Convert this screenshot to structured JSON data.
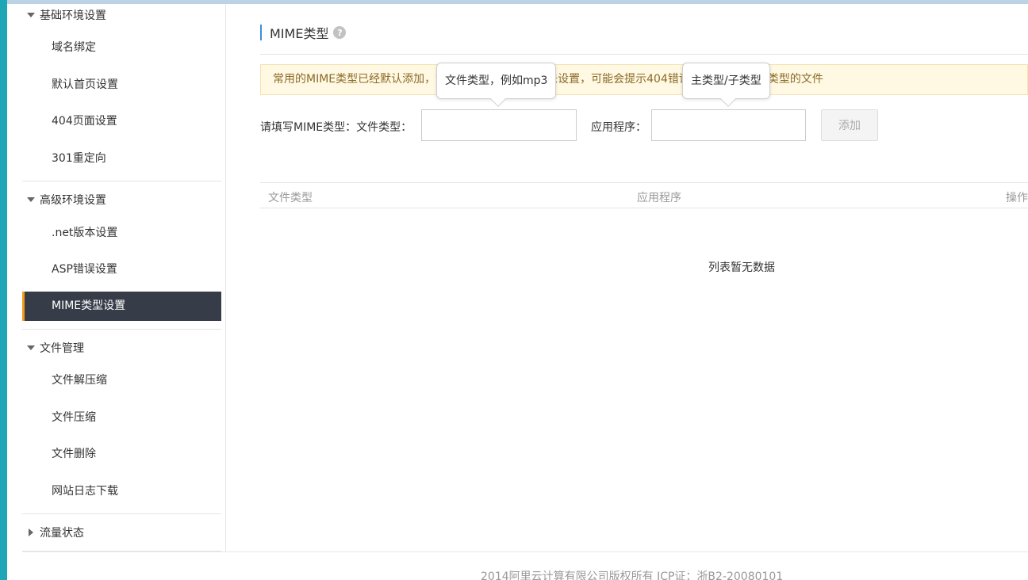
{
  "sidebar": {
    "groups": [
      {
        "label": "基础环境设置",
        "expanded": true,
        "items": [
          "域名绑定",
          "默认首页设置",
          "404页面设置",
          "301重定向"
        ]
      },
      {
        "label": "高级环境设置",
        "expanded": true,
        "items": [
          ".net版本设置",
          "ASP错误设置",
          "MIME类型设置"
        ]
      },
      {
        "label": "文件管理",
        "expanded": true,
        "items": [
          "文件解压缩",
          "文件压缩",
          "文件删除",
          "网站日志下载"
        ]
      },
      {
        "label": "流量状态",
        "expanded": false,
        "items": []
      }
    ],
    "active_item": "MIME类型设置"
  },
  "main": {
    "title": "MIME类型",
    "help_icon": "question-circle-icon",
    "notice": "常用的MIME类型已经默认添加，如果您需要的类型文件未设置，可能会提示404错误或无法打开某些类型的文件",
    "form": {
      "prefix_label": "请填写MIME类型：文件类型：",
      "file_type_value": "",
      "app_label": "应用程序：",
      "app_value": "",
      "add_button": "添加"
    },
    "tooltips": {
      "file_type": "文件类型，例如mp3",
      "app": "主类型/子类型"
    },
    "table": {
      "columns": [
        "文件类型",
        "应用程序",
        "操作"
      ],
      "rows": [],
      "empty_text": "列表暂无数据"
    }
  },
  "footer": {
    "text": "2014阿里云计算有限公司版权所有 ICP证：浙B2-20080101"
  },
  "colors": {
    "accent": "#3b8fd9",
    "active_nav_bg": "#373d48",
    "active_nav_bar": "#f29b1c",
    "notice_bg": "#fff9e3",
    "left_strip": "#1ea6b6"
  }
}
